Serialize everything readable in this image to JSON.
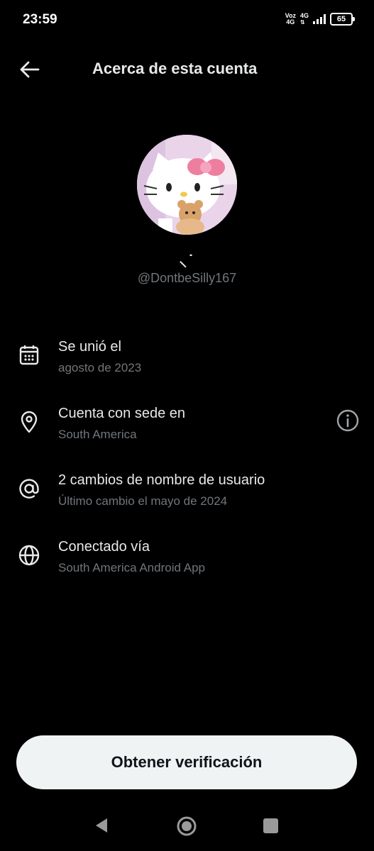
{
  "status_bar": {
    "time": "23:59",
    "carrier_top": "Voz",
    "carrier_bottom": "4G",
    "network": "4G",
    "battery": "65"
  },
  "header": {
    "title": "Acerca de esta cuenta",
    "back_icon": "arrow-left-icon"
  },
  "profile": {
    "display_name": "ᕱ⑅ᕱ",
    "display_name_shown": "⸜˙",
    "handle": "@DontbeSilly167",
    "avatar": "hello-kitty-avatar"
  },
  "info": [
    {
      "icon": "calendar-icon",
      "title": "Se unió el",
      "subtitle": "agosto de 2023"
    },
    {
      "icon": "location-pin-icon",
      "title": "Cuenta con sede en",
      "subtitle": "South America",
      "extra_icon": "info-icon"
    },
    {
      "icon": "at-sign-icon",
      "title": "2 cambios de nombre de usuario",
      "subtitle": "Último cambio el mayo de 2024"
    },
    {
      "icon": "globe-icon",
      "title": "Conectado vía",
      "subtitle": "South America Android App"
    }
  ],
  "cta": {
    "label": "Obtener verificación"
  },
  "nav": {
    "back": "nav-back-icon",
    "home": "nav-home-icon",
    "recents": "nav-recents-icon"
  },
  "colors": {
    "background": "#000000",
    "text_primary": "#e7e9ea",
    "text_secondary": "#71767b",
    "button_bg": "#eff3f4",
    "button_text": "#0f1419"
  }
}
